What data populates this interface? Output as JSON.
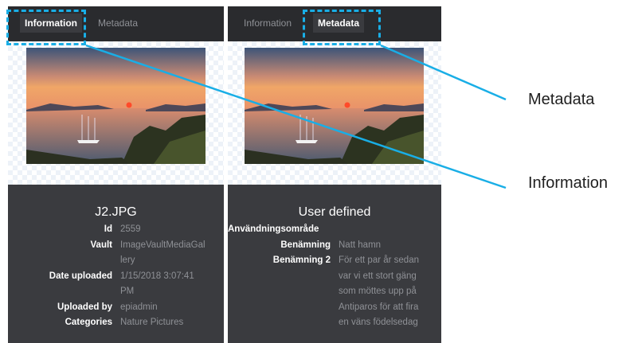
{
  "tabs": {
    "information": "Information",
    "metadata": "Metadata"
  },
  "left_panel": {
    "filename": "J2.JPG",
    "fields": [
      {
        "label": "Id",
        "value_lines": [
          "2559"
        ]
      },
      {
        "label": "Vault",
        "value_lines": [
          "ImageVaultMediaGal",
          "lery"
        ]
      },
      {
        "label": "Date uploaded",
        "value_lines": [
          "1/15/2018 3:07:41",
          "PM"
        ]
      },
      {
        "label": "Uploaded by",
        "value_lines": [
          "epiadmin"
        ]
      },
      {
        "label": "Categories",
        "value_lines": [
          "Nature Pictures"
        ]
      }
    ]
  },
  "right_panel": {
    "section_title": "User defined",
    "field_usage_area": "Användningsområde",
    "fields": [
      {
        "label": "Benämning",
        "value_lines": [
          "Natt hamn"
        ]
      },
      {
        "label": "Benämning 2",
        "value_lines": [
          "För ett par år sedan",
          "var vi ett stort gäng",
          "som möttes upp på",
          "Antiparos för att fira",
          "en väns födelsedag"
        ]
      }
    ]
  },
  "callouts": {
    "metadata": "Metadata",
    "information": "Information"
  },
  "colors": {
    "accent": "#19aee6",
    "panel_bg": "#3a3b3f",
    "tabbar_bg": "#2a2b2e",
    "muted_text": "#8f9196"
  }
}
